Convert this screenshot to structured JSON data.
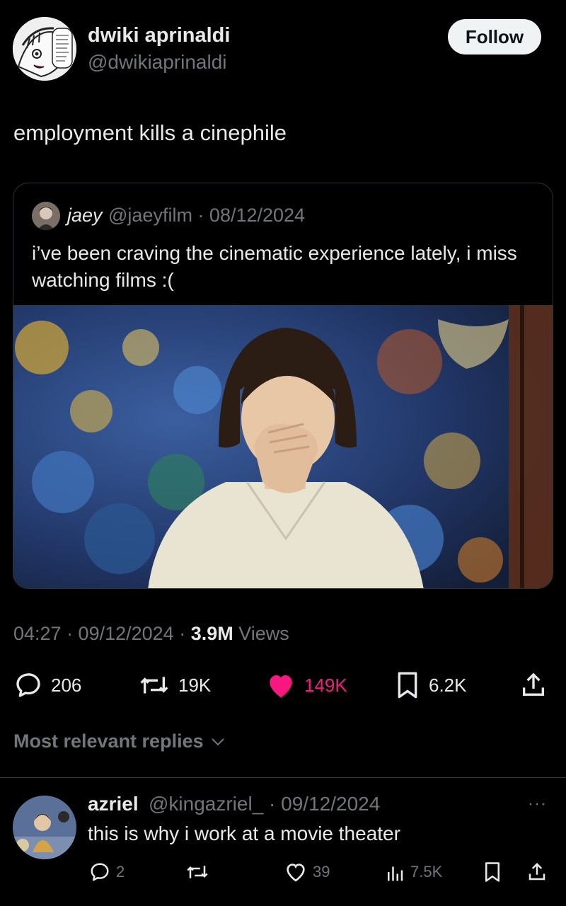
{
  "author": {
    "name": "dwiki aprinaldi",
    "handle": "@dwikiaprinaldi",
    "follow_label": "Follow"
  },
  "tweet": {
    "text": "employment kills a cinephile"
  },
  "quoted": {
    "name": "jaey",
    "handle_date": "@jaeyfilm · 08/12/2024",
    "text": "i’ve been craving the cinematic experience lately, i miss watching films :("
  },
  "meta": {
    "time_date": "04:27 · 09/12/2024 · ",
    "views_count": "3.9M",
    "views_label": " Views"
  },
  "stats": {
    "replies": "206",
    "reposts": "19K",
    "likes": "149K",
    "bookmarks": "6.2K"
  },
  "sort": {
    "label": "Most relevant replies"
  },
  "reply": {
    "name": "azriel",
    "handle_date": "@kingazriel_ · 09/12/2024",
    "more": "···",
    "text": "this is why i work at a movie theater",
    "replies": "2",
    "likes": "39",
    "views": "7.5K"
  },
  "colors": {
    "background": "#000000",
    "text": "#e7e9ea",
    "muted": "#71767b",
    "like_active": "#f91880",
    "border": "#2f3336"
  }
}
